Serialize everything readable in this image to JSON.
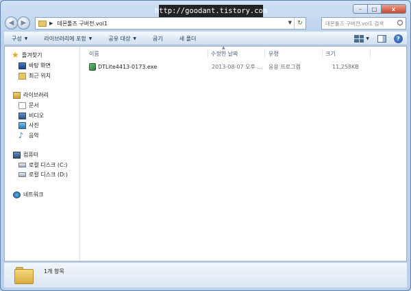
{
  "watermark": "http://goodant.tistory.com",
  "window_controls": {
    "minimize": "–",
    "maximize": "□",
    "close": "x"
  },
  "address_bar": {
    "path": "데몬툴즈 구버전.vol1",
    "separator": "▶"
  },
  "search": {
    "placeholder": "데몬툴즈 구버전.vol1 검색"
  },
  "toolbar": {
    "organize": "구성",
    "include_library": "라이브러리에 포함",
    "share": "공유 대상",
    "burn": "굽기",
    "new_folder": "새 폴더"
  },
  "nav": {
    "favorites": "즐겨찾기",
    "desktop": "바탕 화면",
    "recent": "최근 위치",
    "libraries": "라이브러리",
    "documents": "문서",
    "videos": "비디오",
    "pictures": "사진",
    "music": "음악",
    "computer": "컴퓨터",
    "drive_c": "로컬 디스크 (C:)",
    "drive_d": "로컬 디스크 (D:)",
    "network": "네트워크"
  },
  "columns": {
    "name": "이름",
    "date": "수정한 날짜",
    "type": "유형",
    "size": "크기"
  },
  "files": [
    {
      "name": "DTLite4413-0173.exe",
      "date": "2013-08-07 오후 ...",
      "type": "응용 프로그램",
      "size": "11,258KB"
    }
  ],
  "details": {
    "item_count": "1개 항목"
  }
}
